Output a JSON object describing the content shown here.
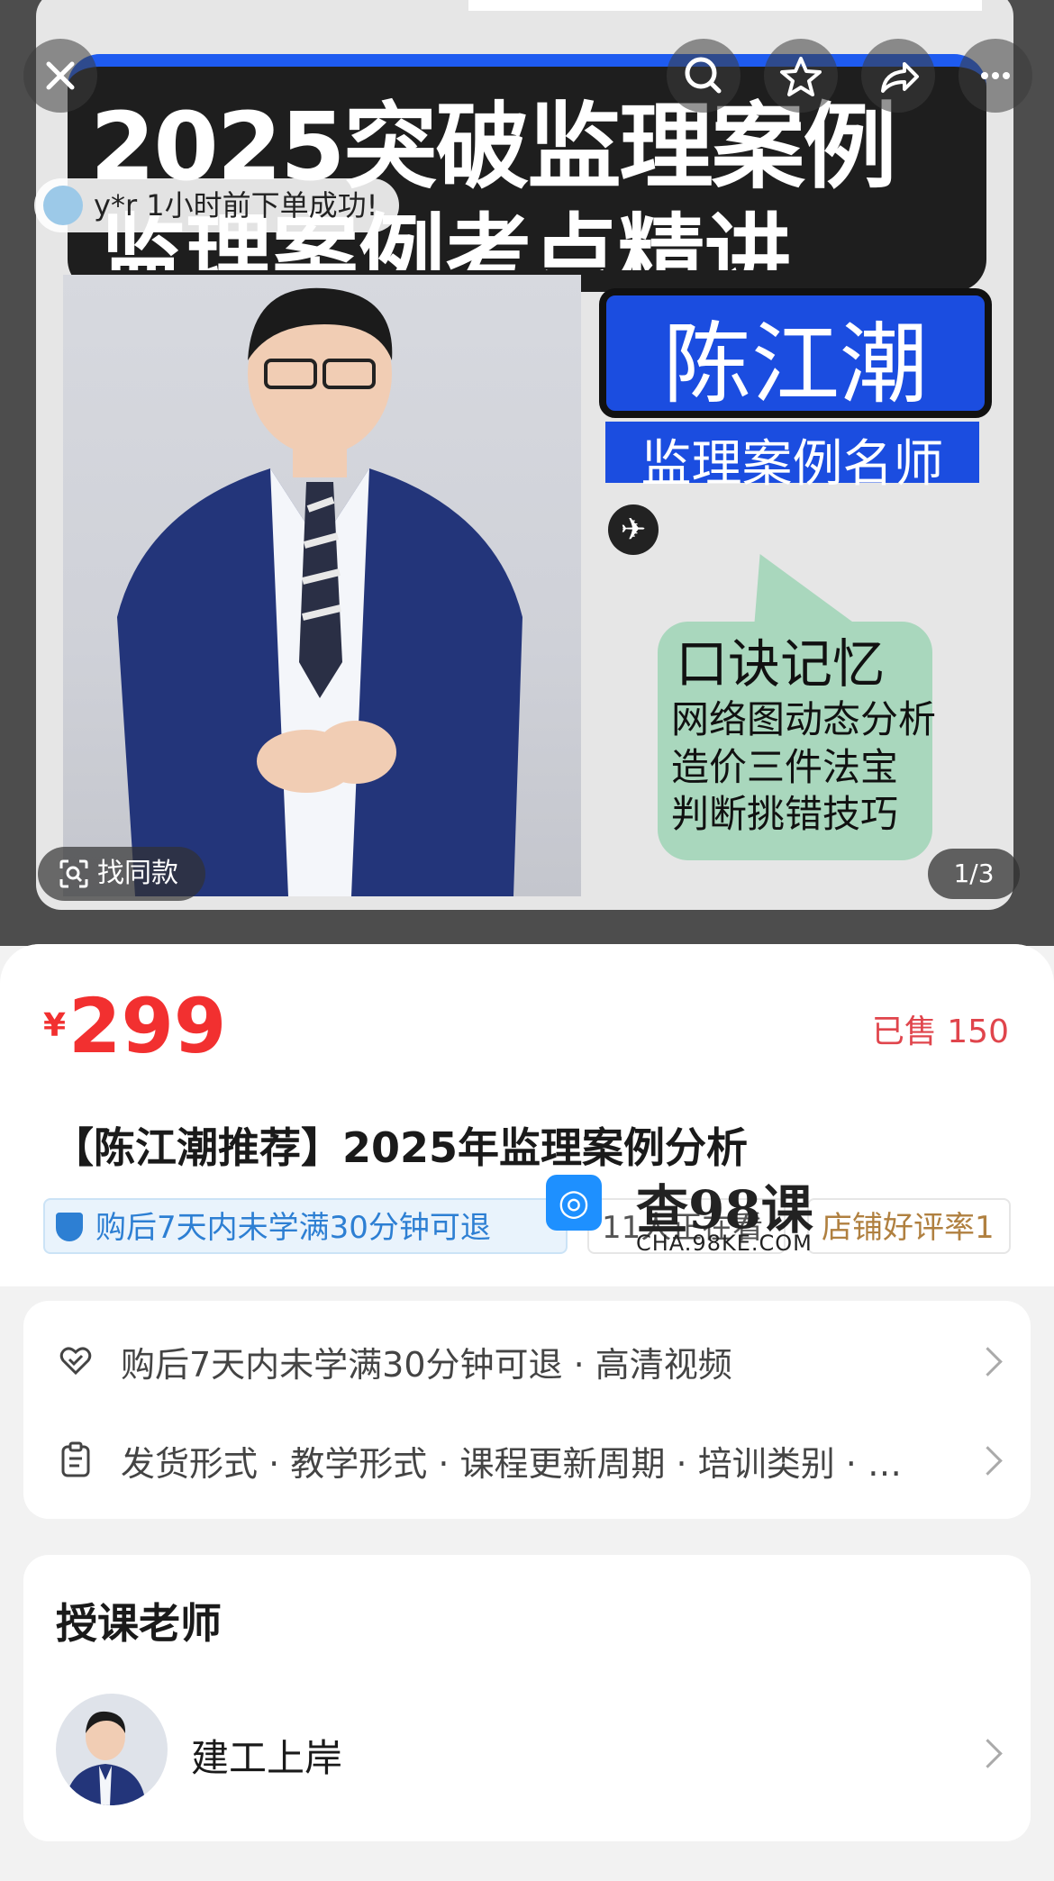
{
  "top_bar": {
    "close_icon": "close-icon",
    "search_icon": "search-icon",
    "favorite_icon": "star-icon",
    "share_icon": "share-icon",
    "more_icon": "more-icon"
  },
  "toast": {
    "user": "y*r",
    "message": "1小时前下单成功!"
  },
  "poster": {
    "headline_1": "2025突破监理案例",
    "headline_2": "监理案例考点精讲",
    "teacher_name": "陈江潮",
    "teacher_title": "监理案例名师",
    "bubble": [
      "口诀记忆",
      "网络图动态分析",
      "造价三件法宝",
      "判断挑错技巧"
    ]
  },
  "find_same": {
    "label": "找同款"
  },
  "pager": {
    "text": "1/3"
  },
  "product": {
    "currency": "¥",
    "price": "299",
    "sold": "已售 150",
    "title": "【陈江潮推荐】2025年监理案例分析",
    "tags": [
      "购后7天内未学满30分钟可退",
      "11人正在看",
      "店铺好评率1"
    ]
  },
  "watermark": {
    "name": "查98课",
    "site": "CHA.98KE.COM"
  },
  "services": {
    "row1": "购后7天内未学满30分钟可退 · 高清视频",
    "row2": "发货形式 · 教学形式 · 课程更新周期 · 培训类别 · …"
  },
  "teacher_section": {
    "title": "授课老师",
    "name": "建工上岸"
  },
  "colors": {
    "price": "#f23030",
    "accent_blue": "#1b4de0",
    "tag_blue": "#2d7fd3"
  }
}
